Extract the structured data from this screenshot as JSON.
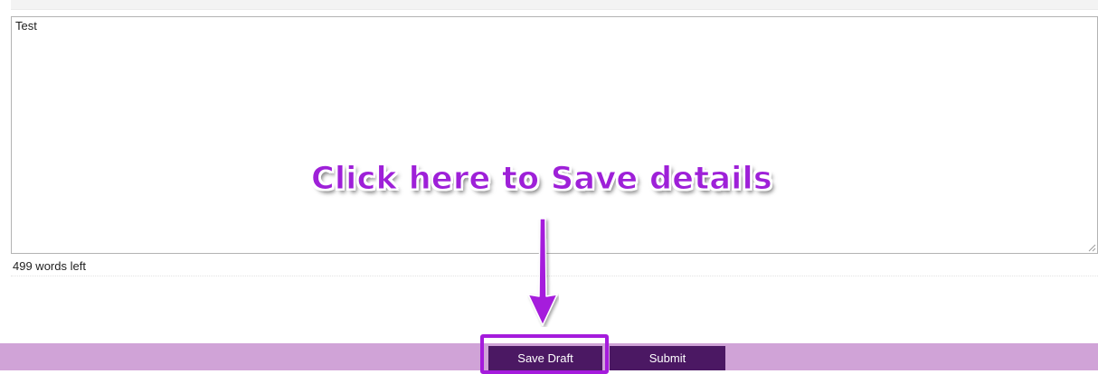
{
  "editor": {
    "value": "Test"
  },
  "word_count": {
    "text": "499 words left"
  },
  "annotation": {
    "callout_text": "Click here to Save details",
    "callout_color": "#9e20d8",
    "arrow_icon": "down-arrow-icon"
  },
  "actions": {
    "save_draft_label": "Save Draft",
    "submit_label": "Submit"
  },
  "colors": {
    "action_bar": "#d0a3d7",
    "button_bg": "#4b1863",
    "button_text": "#ffffff",
    "highlight_border": "#a51bdc"
  }
}
